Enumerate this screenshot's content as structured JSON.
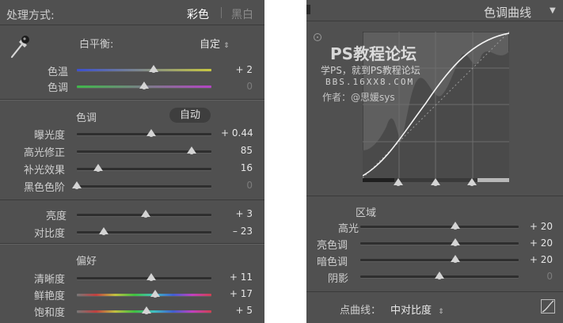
{
  "basic": {
    "treatment_label": "处理方式:",
    "color_option": "彩色",
    "bw_option": "黑白",
    "wb_label": "白平衡:",
    "wb_value": "自定",
    "temp_label": "色温",
    "temp_value": "+ 2",
    "temp_level": 0.57,
    "tint_label": "色调",
    "tint_value": "0",
    "tint_level": 0.5,
    "tone_label": "色调",
    "auto_label": "自动",
    "exposure_label": "曝光度",
    "exposure_value": "+ 0.44",
    "exposure_level": 0.55,
    "highlights_label": "高光修正",
    "highlights_value": "85",
    "highlights_level": 0.85,
    "fill_label": "补光效果",
    "fill_value": "16",
    "fill_level": 0.16,
    "blacks_label": "黑色色阶",
    "blacks_value": "0",
    "blacks_level": 0.0,
    "brightness_label": "亮度",
    "brightness_value": "+ 3",
    "brightness_level": 0.51,
    "contrast_label": "对比度",
    "contrast_value": "– 23",
    "contrast_level": 0.2,
    "presence_label": "偏好",
    "clarity_label": "清晰度",
    "clarity_value": "+ 11",
    "clarity_level": 0.55,
    "vibrance_label": "鲜艳度",
    "vibrance_value": "+ 17",
    "vibrance_level": 0.58,
    "saturation_label": "饱和度",
    "saturation_value": "+ 5",
    "saturation_level": 0.52
  },
  "curve": {
    "title": "色调曲线",
    "watermark_title": "PS教程论坛",
    "watermark_sub": "学PS，就到PS教程论坛",
    "watermark_url": "BBS.16XX8.COM",
    "watermark_author": "作者：@思媛sys",
    "region_label": "区域",
    "highlights_label": "高光",
    "highlights_value": "+ 20",
    "highlights_level": 0.6,
    "lights_label": "亮色调",
    "lights_value": "+ 20",
    "lights_level": 0.6,
    "darks_label": "暗色调",
    "darks_value": "+ 20",
    "darks_level": 0.6,
    "shadows_label": "阴影",
    "shadows_value": "0",
    "shadows_level": 0.5,
    "point_curve_label": "点曲线：",
    "point_curve_value": "中对比度"
  }
}
